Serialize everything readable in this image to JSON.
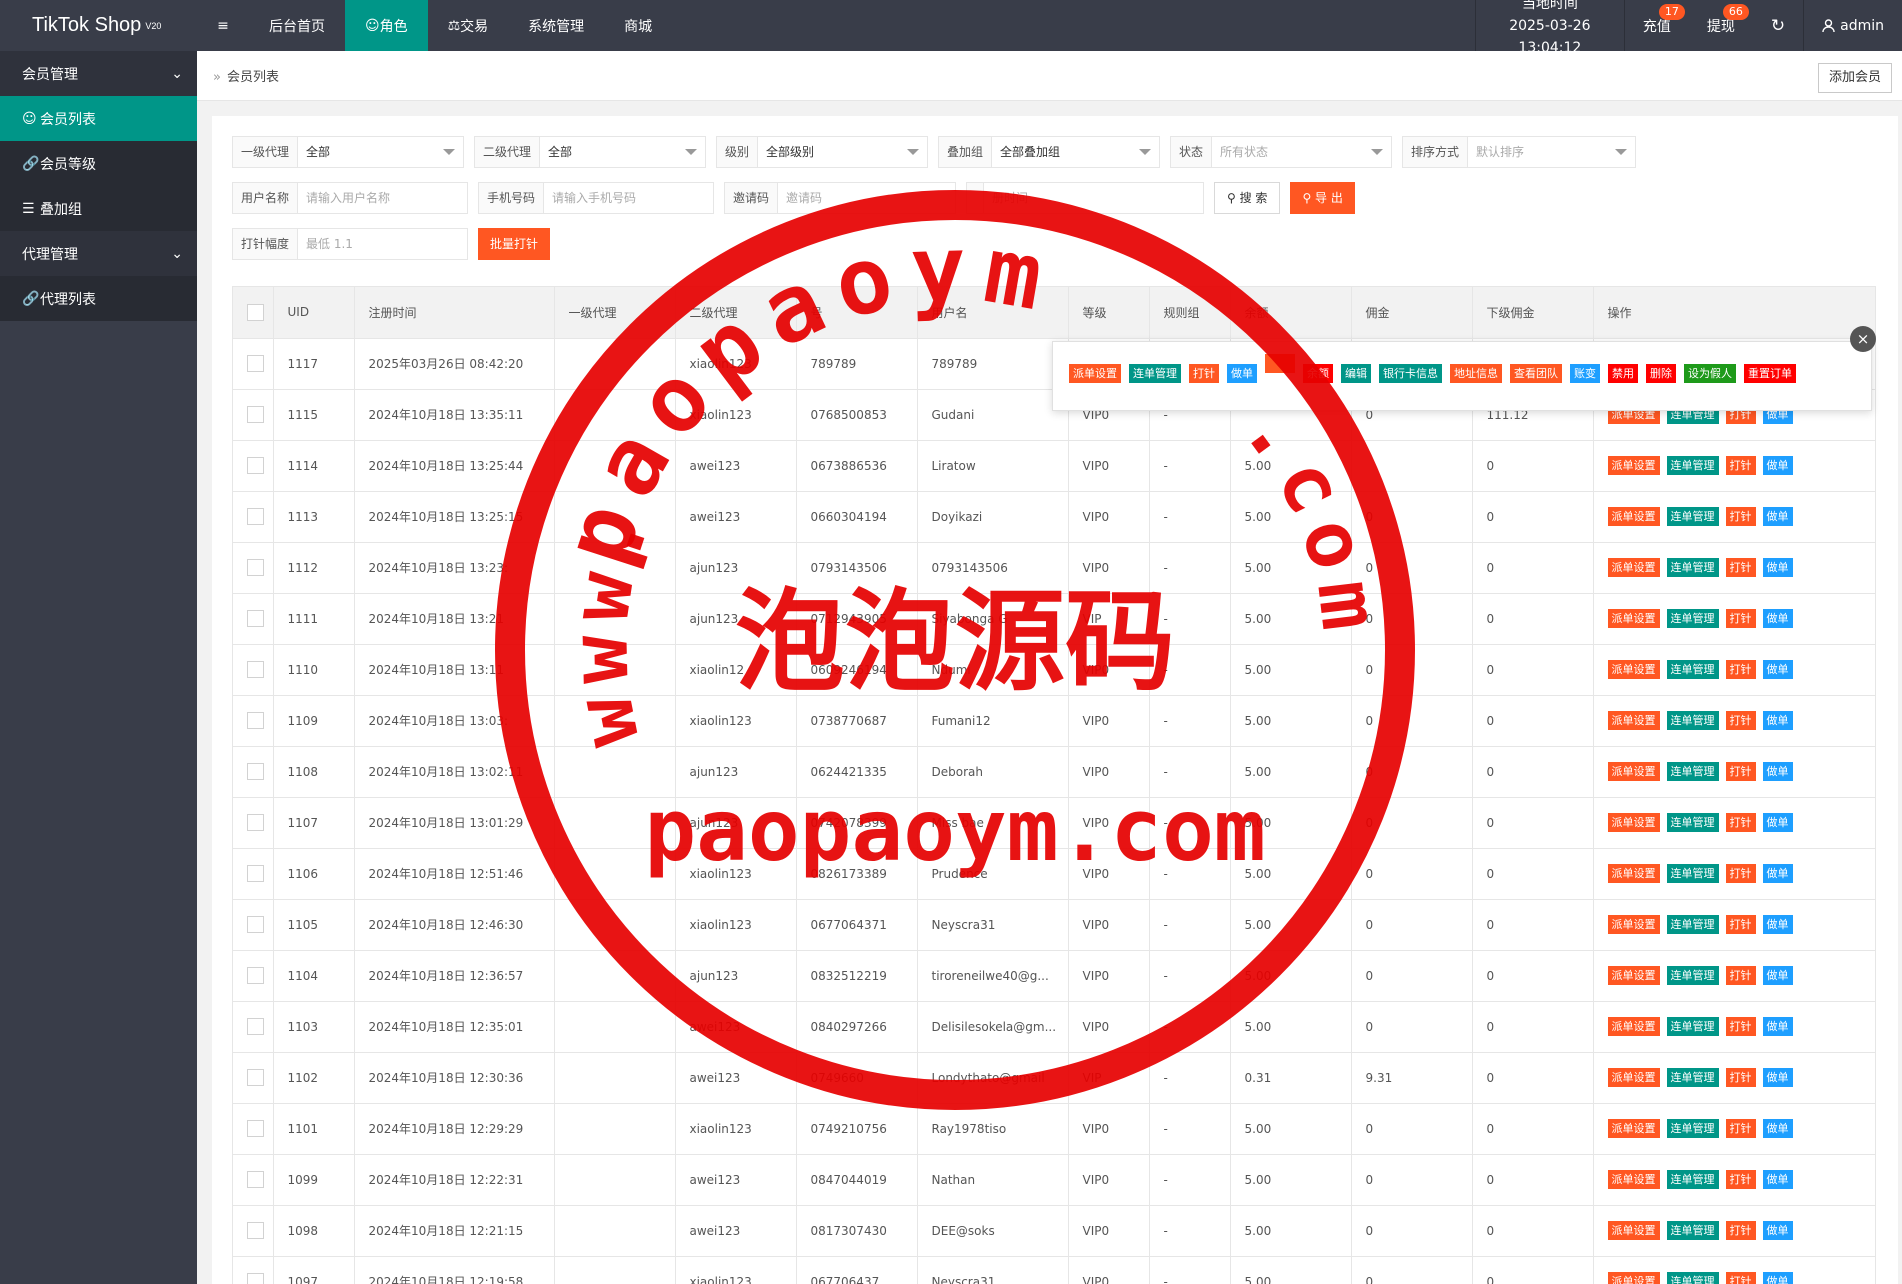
{
  "app": {
    "logo": "TikTok Shop",
    "version": "V20"
  },
  "topnav": {
    "toggle_icon": "≡",
    "items": [
      {
        "label": "后台首页",
        "active": false
      },
      {
        "label": "角色",
        "active": true
      },
      {
        "label": "交易",
        "active": false
      },
      {
        "label": "系统管理",
        "active": false
      },
      {
        "label": "商城",
        "active": false
      }
    ],
    "time_label": "当地时间",
    "time_value": "2025-03-26 13:04:12",
    "recharge": {
      "label": "充值",
      "badge": "17"
    },
    "withdraw": {
      "label": "提现",
      "badge": "66"
    },
    "refresh_icon": "↻",
    "user": "admin"
  },
  "sidebar": {
    "groups": [
      {
        "label": "会员管理",
        "items": [
          {
            "icon": "user-icon",
            "label": "会员列表",
            "active": true
          },
          {
            "icon": "link-icon",
            "label": "会员等级",
            "active": false
          },
          {
            "icon": "list-icon",
            "label": "叠加组",
            "active": false
          }
        ]
      },
      {
        "label": "代理管理",
        "items": [
          {
            "icon": "link-icon",
            "label": "代理列表",
            "active": false
          }
        ]
      }
    ]
  },
  "breadcrumb": {
    "current": "会员列表"
  },
  "add_button": "添加会员",
  "filters": {
    "row1": [
      {
        "label": "一级代理",
        "value": "全部",
        "placeholder": false
      },
      {
        "label": "二级代理",
        "value": "全部",
        "placeholder": false
      },
      {
        "label": "级别",
        "value": "全部级别",
        "placeholder": false
      },
      {
        "label": "叠加组",
        "value": "全部叠加组",
        "placeholder": false
      },
      {
        "label": "状态",
        "value": "所有状态",
        "placeholder": true
      },
      {
        "label": "排序方式",
        "value": "默认排序",
        "placeholder": true
      }
    ],
    "row2": [
      {
        "label": "用户名称",
        "placeholder": "请输入用户名称"
      },
      {
        "label": "手机号码",
        "placeholder": "请输入手机号码"
      },
      {
        "label": "邀请码",
        "placeholder": "邀请码"
      },
      {
        "label": "",
        "placeholder": "册时间"
      }
    ],
    "search_button": "搜 索",
    "export_button": "导 出",
    "row3": {
      "label": "打针幅度",
      "placeholder": "最低 1.1",
      "button": "批量打针"
    }
  },
  "table": {
    "headers": [
      "UID",
      "注册时间",
      "一级代理",
      "二级代理",
      "号",
      "用户名",
      "等级",
      "规则组",
      "余额",
      "佣金",
      "下级佣金",
      "操作"
    ],
    "actions": [
      "派单设置",
      "连单管理",
      "打针",
      "做单"
    ],
    "rows": [
      {
        "uid": "1117",
        "reg": "2025年03月26日 08:42:20",
        "a1": "",
        "a2": "xiaolin123",
        "phone": "789789",
        "user": "789789",
        "level": "",
        "group": "",
        "balance": "",
        "comm": "",
        "sub": ""
      },
      {
        "uid": "1115",
        "reg": "2024年10月18日 13:35:11",
        "a1": "",
        "a2": "xiaolin123",
        "phone": "0768500853",
        "user": "Gudani",
        "level": "VIP0",
        "group": "-",
        "balance": "",
        "comm": "0",
        "sub": "111.12"
      },
      {
        "uid": "1114",
        "reg": "2024年10月18日 13:25:44",
        "a1": "",
        "a2": "awei123",
        "phone": "0673886536",
        "user": "Liratow",
        "level": "VIP0",
        "group": "-",
        "balance": "5.00",
        "comm": "",
        "sub": "0"
      },
      {
        "uid": "1113",
        "reg": "2024年10月18日 13:25:15",
        "a1": "",
        "a2": "awei123",
        "phone": "0660304194",
        "user": "Doyikazi",
        "level": "VIP0",
        "group": "-",
        "balance": "5.00",
        "comm": "0",
        "sub": "0"
      },
      {
        "uid": "1112",
        "reg": "2024年10月18日 13:23:",
        "a1": "",
        "a2": "ajun123",
        "phone": "0793143506",
        "user": "0793143506",
        "level": "VIP0",
        "group": "-",
        "balance": "5.00",
        "comm": "0",
        "sub": "0"
      },
      {
        "uid": "1111",
        "reg": "2024年10月18日 13:21",
        "a1": "",
        "a2": "ajun123",
        "phone": "0712943905",
        "user": "Siyabonga G",
        "level": "VIP",
        "group": "-",
        "balance": "5.00",
        "comm": "0",
        "sub": "0"
      },
      {
        "uid": "1110",
        "reg": "2024年10月18日 13:11",
        "a1": "",
        "a2": "xiaolin12",
        "phone": "0609246194",
        "user": "Ndumi",
        "level": "VIP0",
        "group": "-",
        "balance": "5.00",
        "comm": "0",
        "sub": "0"
      },
      {
        "uid": "1109",
        "reg": "2024年10月18日 13:03:",
        "a1": "",
        "a2": "xiaolin123",
        "phone": "0738770687",
        "user": "Fumani12",
        "level": "VIP0",
        "group": "-",
        "balance": "5.00",
        "comm": "0",
        "sub": "0"
      },
      {
        "uid": "1108",
        "reg": "2024年10月18日 13:02:11",
        "a1": "",
        "a2": "ajun123",
        "phone": "0624421335",
        "user": "Deborah",
        "level": "VIP0",
        "group": "-",
        "balance": "5.00",
        "comm": "0",
        "sub": "0"
      },
      {
        "uid": "1107",
        "reg": "2024年10月18日 13:01:29",
        "a1": "",
        "a2": "ajun123",
        "phone": "0742078399",
        "user": "Miss bae",
        "level": "VIP0",
        "group": "-",
        "balance": "5.00",
        "comm": "0",
        "sub": "0"
      },
      {
        "uid": "1106",
        "reg": "2024年10月18日 12:51:46",
        "a1": "",
        "a2": "xiaolin123",
        "phone": "0826173389",
        "user": "Prudence",
        "level": "VIP0",
        "group": "-",
        "balance": "5.00",
        "comm": "0",
        "sub": "0"
      },
      {
        "uid": "1105",
        "reg": "2024年10月18日 12:46:30",
        "a1": "",
        "a2": "xiaolin123",
        "phone": "0677064371",
        "user": "Neyscra31",
        "level": "VIP0",
        "group": "-",
        "balance": "5.00",
        "comm": "0",
        "sub": "0"
      },
      {
        "uid": "1104",
        "reg": "2024年10月18日 12:36:57",
        "a1": "",
        "a2": "ajun123",
        "phone": "0832512219",
        "user": "tiroreneilwe40@g...",
        "level": "VIP0",
        "group": "-",
        "balance": "5.00",
        "comm": "0",
        "sub": "0"
      },
      {
        "uid": "1103",
        "reg": "2024年10月18日 12:35:01",
        "a1": "",
        "a2": "awei123",
        "phone": "0840297266",
        "user": "Delisilesokela@gm...",
        "level": "VIP0",
        "group": "-",
        "balance": "5.00",
        "comm": "0",
        "sub": "0"
      },
      {
        "uid": "1102",
        "reg": "2024年10月18日 12:30:36",
        "a1": "",
        "a2": "awei123",
        "phone": "0749660",
        "user": "Londythato@gmail",
        "level": "VIP",
        "group": "-",
        "balance": "0.31",
        "comm": "9.31",
        "sub": "0"
      },
      {
        "uid": "1101",
        "reg": "2024年10月18日 12:29:29",
        "a1": "",
        "a2": "xiaolin123",
        "phone": "0749210756",
        "user": "Ray1978tiso",
        "level": "VIP0",
        "group": "-",
        "balance": "5.00",
        "comm": "0",
        "sub": "0"
      },
      {
        "uid": "1099",
        "reg": "2024年10月18日 12:22:31",
        "a1": "",
        "a2": "awei123",
        "phone": "0847044019",
        "user": "Nathan",
        "level": "VIP0",
        "group": "-",
        "balance": "5.00",
        "comm": "0",
        "sub": "0"
      },
      {
        "uid": "1098",
        "reg": "2024年10月18日 12:21:15",
        "a1": "",
        "a2": "awei123",
        "phone": "0817307430",
        "user": "DEE@soks",
        "level": "VIP0",
        "group": "-",
        "balance": "5.00",
        "comm": "0",
        "sub": "0"
      },
      {
        "uid": "1097",
        "reg": "2024年10月18日 12:19:58",
        "a1": "",
        "a2": "xiaolin123",
        "phone": "067706437",
        "user": "Neyscra31",
        "level": "VIP0",
        "group": "-",
        "balance": "5.00",
        "comm": "0",
        "sub": "0"
      }
    ]
  },
  "popup": {
    "buttons": [
      {
        "label": "派单设置",
        "color": "#ff5722"
      },
      {
        "label": "连单管理",
        "color": "#009688"
      },
      {
        "label": "打针",
        "color": "#ff5722"
      },
      {
        "label": "做单",
        "color": "#1e9fff"
      },
      {
        "label": "",
        "color": "#ff5722"
      },
      {
        "label": "余额",
        "color": "#ff0000"
      },
      {
        "label": "编辑",
        "color": "#009688"
      },
      {
        "label": "银行卡信息",
        "color": "#009688"
      },
      {
        "label": "地址信息",
        "color": "#ff5722"
      },
      {
        "label": "查看团队",
        "color": "#ff5722"
      },
      {
        "label": "账变",
        "color": "#1e9fff"
      },
      {
        "label": "禁用",
        "color": "#ff0000"
      },
      {
        "label": "删除",
        "color": "#ff0000"
      },
      {
        "label": "设为假人",
        "color": "#1e9a1a"
      },
      {
        "label": "重置订单",
        "color": "#ff0000"
      }
    ],
    "close_icon": "×"
  },
  "watermark": {
    "top_arc": "paopaoym",
    "side_arc": "www.",
    "bottom_arc": ".com",
    "center": "泡泡源码",
    "bottom_text": "paopaoym.com",
    "color": "#e60000"
  }
}
